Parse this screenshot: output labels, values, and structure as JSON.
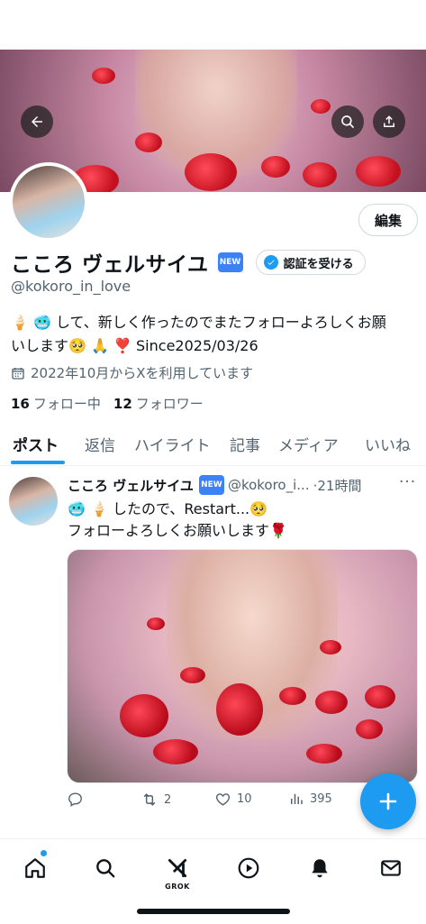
{
  "profile": {
    "display_name": "こころ ヴェルサイユ",
    "new_badge": "NEW",
    "verify_button": "認証を受ける",
    "handle": "@kokoro_in_love",
    "bio_line1": "🍦 🥶 して、新しく作ったのでまたフォローよろしくお願",
    "bio_line2": "いします🥺 🙏 ❣️ Since2025/03/26",
    "joined": "2022年10月からXを利用しています",
    "following_count": "16",
    "following_label": "フォロー中",
    "followers_count": "12",
    "followers_label": "フォロワー",
    "edit_button": "編集"
  },
  "tabs": [
    {
      "label": "ポスト"
    },
    {
      "label": "返信"
    },
    {
      "label": "ハイライト"
    },
    {
      "label": "記事"
    },
    {
      "label": "メディア"
    },
    {
      "label": "いいね"
    }
  ],
  "post": {
    "author": "こころ ヴェルサイユ",
    "new_badge": "NEW",
    "handle": "@kokoro_i...",
    "time": "·21時間",
    "more": "···",
    "text_line1": "🥶 🍦 したので、Restart...🥺",
    "text_line2": "フォローよろしくお願いします🌹",
    "replies": "",
    "reposts": "2",
    "likes": "10",
    "views": "395"
  },
  "nav": {
    "grok_label": "GROK"
  },
  "colors": {
    "accent": "#1d9bf0",
    "text": "#0f1419",
    "muted": "#536471"
  },
  "icons": [
    "back-arrow-icon",
    "search-icon",
    "share-icon",
    "calendar-icon",
    "reply-icon",
    "repost-icon",
    "like-icon",
    "views-icon",
    "plus-icon",
    "home-icon",
    "grok-icon",
    "play-icon",
    "bell-icon",
    "mail-icon"
  ]
}
